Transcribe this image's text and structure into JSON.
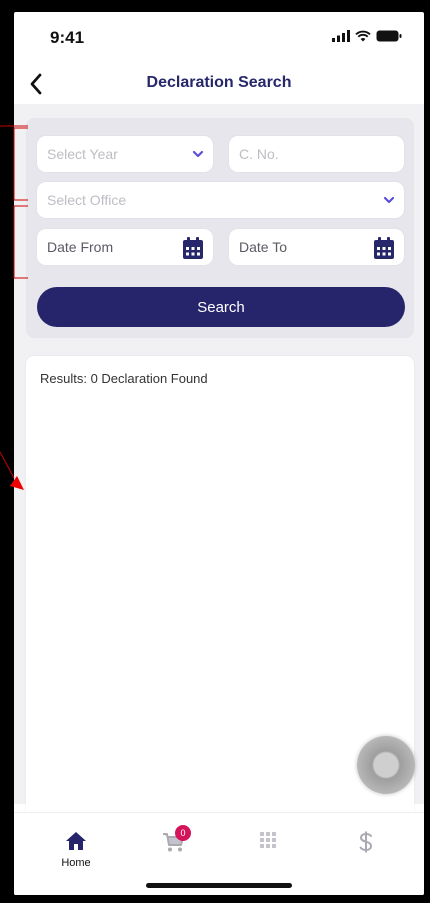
{
  "status_bar": {
    "time": "9:41"
  },
  "header": {
    "title": "Declaration Search"
  },
  "search_form": {
    "year_placeholder": "Select Year",
    "cno_placeholder": "C. No.",
    "office_placeholder": "Select Office",
    "date_from_label": "Date From",
    "date_to_label": "Date To",
    "search_label": "Search"
  },
  "results": {
    "text": "Results: 0 Declaration Found"
  },
  "bottom_nav": {
    "home_label": "Home",
    "cart_badge": "0"
  },
  "colors": {
    "brand": "#26246a",
    "accent": "#6a5cd8",
    "badge": "#d4145a",
    "annotation": "#cc0000"
  }
}
